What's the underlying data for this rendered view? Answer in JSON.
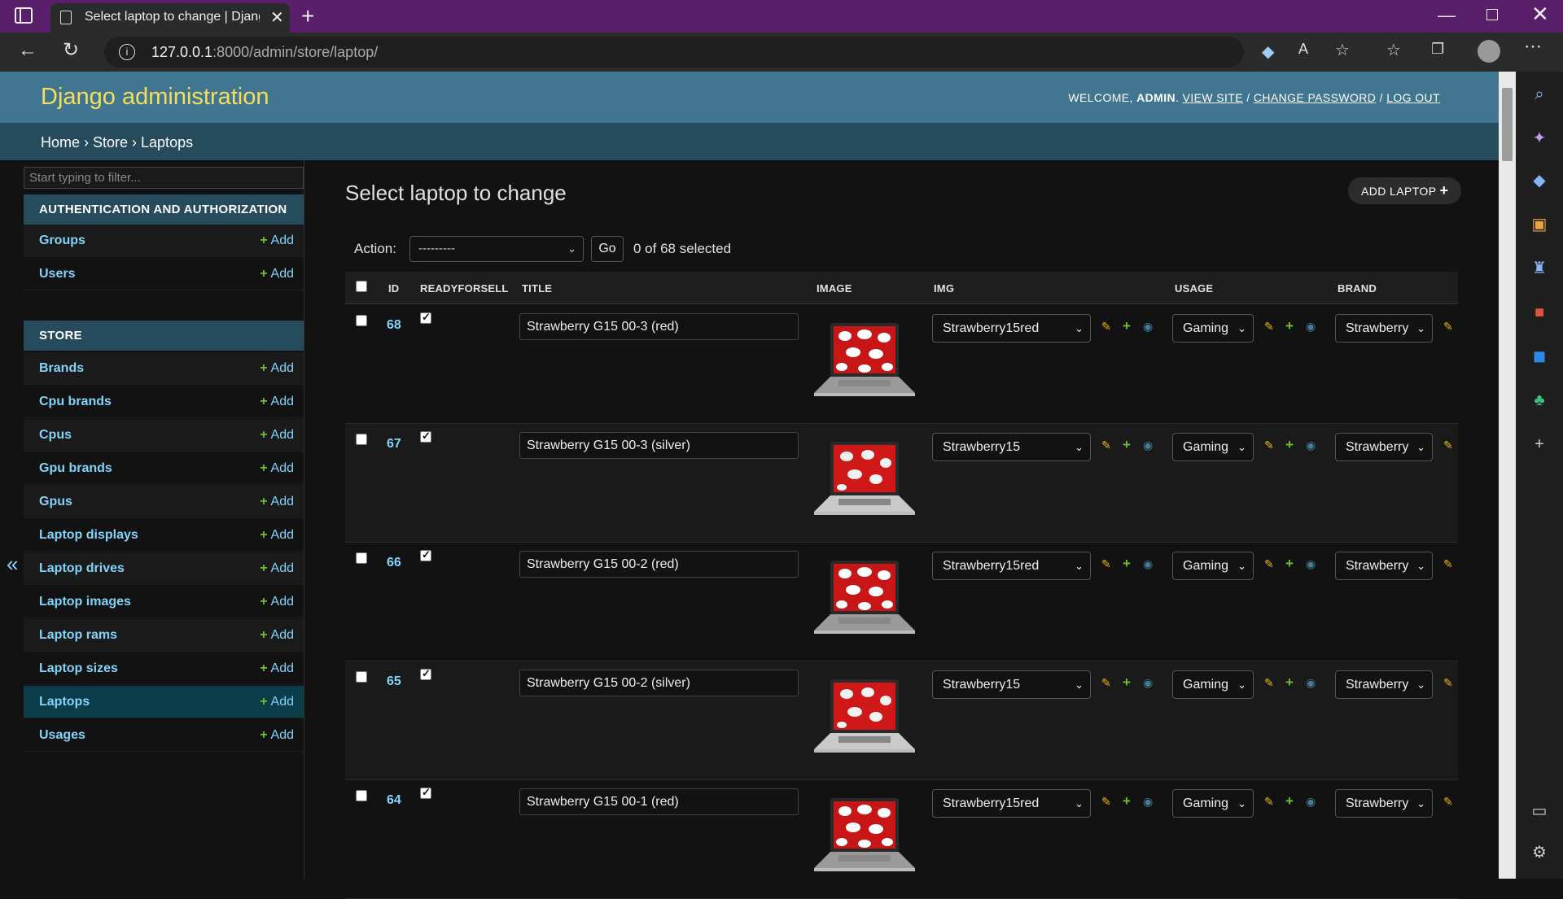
{
  "browser": {
    "tab_title": "Select laptop to change | Django",
    "url_host": "127.0.0.1",
    "url_path": ":8000/admin/store/laptop/"
  },
  "header": {
    "brand": "Django administration",
    "welcome": "WELCOME,",
    "user": "ADMIN",
    "view_site": "VIEW SITE",
    "change_password": "CHANGE PASSWORD",
    "logout": "LOG OUT"
  },
  "breadcrumbs": "Home › Store › Laptops",
  "sidebar": {
    "filter_placeholder": "Start typing to filter...",
    "add_label": "Add",
    "auth_caption": "AUTHENTICATION AND AUTHORIZATION",
    "auth_models": [
      "Groups",
      "Users"
    ],
    "store_caption": "STORE",
    "store_models": [
      "Brands",
      "Cpu brands",
      "Cpus",
      "Gpu brands",
      "Gpus",
      "Laptop displays",
      "Laptop drives",
      "Laptop images",
      "Laptop rams",
      "Laptop sizes",
      "Laptops",
      "Usages"
    ],
    "current": "Laptops"
  },
  "content": {
    "title": "Select laptop to change",
    "add_button": "ADD LAPTOP",
    "action_label": "Action:",
    "action_value": "---------",
    "go_label": "Go",
    "selected": "0 of 68 selected",
    "columns": [
      "ID",
      "READYFORSELL",
      "TITLE",
      "IMAGE",
      "IMG",
      "USAGE",
      "BRAND"
    ],
    "rows": [
      {
        "id": "68",
        "ready": true,
        "title": "Strawberry G15 00-3 (red)",
        "img": "Strawberry15red",
        "usage": "Gaming",
        "brand": "Strawberry",
        "screen": "red"
      },
      {
        "id": "67",
        "ready": true,
        "title": "Strawberry G15 00-3 (silver)",
        "img": "Strawberry15",
        "usage": "Gaming",
        "brand": "Strawberry",
        "screen": "silver"
      },
      {
        "id": "66",
        "ready": true,
        "title": "Strawberry G15 00-2 (red)",
        "img": "Strawberry15red",
        "usage": "Gaming",
        "brand": "Strawberry",
        "screen": "red"
      },
      {
        "id": "65",
        "ready": true,
        "title": "Strawberry G15 00-2 (silver)",
        "img": "Strawberry15",
        "usage": "Gaming",
        "brand": "Strawberry",
        "screen": "silver"
      },
      {
        "id": "64",
        "ready": true,
        "title": "Strawberry G15 00-1 (red)",
        "img": "Strawberry15red",
        "usage": "Gaming",
        "brand": "Strawberry",
        "screen": "red"
      }
    ]
  },
  "colors": {
    "header_bg": "#417690",
    "brand_text": "#f5dd5d",
    "breadcrumb_bg": "#264b5d",
    "link": "#81d4fa",
    "add_plus": "#70bf2b",
    "titlebar": "#5a1f6b"
  }
}
